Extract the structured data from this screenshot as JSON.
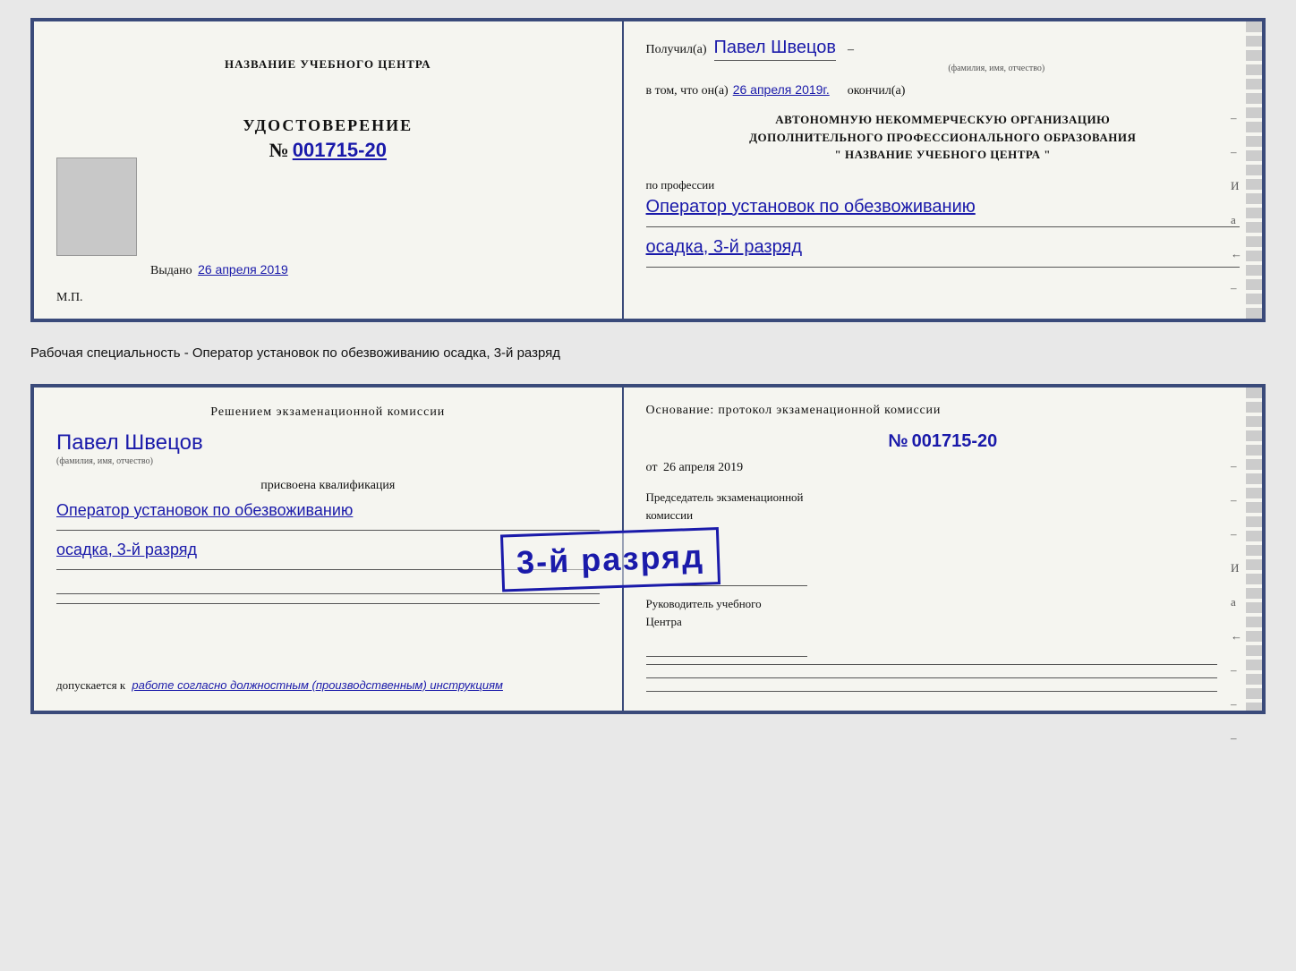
{
  "doc1": {
    "left": {
      "center_title": "НАЗВАНИЕ УЧЕБНОГО ЦЕНТРА",
      "cert_title": "УДОСТОВЕРЕНИЕ",
      "cert_number_prefix": "№",
      "cert_number": "001715-20",
      "issued_label": "Выдано",
      "issued_date": "26 апреля 2019",
      "mp_label": "М.П."
    },
    "right": {
      "received_prefix": "Получил(а)",
      "received_name": "Павел Швецов",
      "fio_label": "(фамилия, имя, отчество)",
      "in_that_prefix": "в том, что он(а)",
      "in_that_date": "26 апреля 2019г.",
      "finished_label": "окончил(а)",
      "org_text_line1": "АВТОНОМНУЮ НЕКОММЕРЧЕСКУЮ ОРГАНИЗАЦИЮ",
      "org_text_line2": "ДОПОЛНИТЕЛЬНОГО ПРОФЕССИОНАЛЬНОГО ОБРАЗОВАНИЯ",
      "org_text_line3": "\"   НАЗВАНИЕ УЧЕБНОГО ЦЕНТРА   \"",
      "profession_label": "по профессии",
      "profession_line1": "Оператор установок по обезвоживанию",
      "profession_line2": "осадка, 3-й разряд",
      "dash1": "–",
      "dash2": "–",
      "letter_i": "И",
      "letter_a": "а",
      "arrow": "←"
    }
  },
  "between": {
    "text": "Рабочая специальность - Оператор установок по обезвоживанию осадка, 3-й разряд"
  },
  "doc2": {
    "left": {
      "decision_text": "Решением экзаменационной комиссии",
      "person_name": "Павел Швецов",
      "fio_label": "(фамилия, имя, отчество)",
      "assigned_text": "присвоена квалификация",
      "qualification_line1": "Оператор установок по обезвоживанию",
      "qualification_line2": "осадка, 3-й разряд",
      "allowed_prefix": "допускается к",
      "allowed_text": "работе согласно должностным (производственным) инструкциям"
    },
    "stamp": {
      "text": "3-й разряд"
    },
    "right": {
      "basis_text": "Основание: протокол экзаменационной комиссии",
      "number_prefix": "№",
      "number": "001715-20",
      "date_prefix": "от",
      "date": "26 апреля 2019",
      "chairman_line1": "Председатель экзаменационной",
      "chairman_line2": "комиссии",
      "leader_line1": "Руководитель учебного",
      "leader_line2": "Центра",
      "dash1": "–",
      "dash2": "–",
      "letter_i": "И",
      "letter_a": "а",
      "arrow": "←"
    }
  }
}
